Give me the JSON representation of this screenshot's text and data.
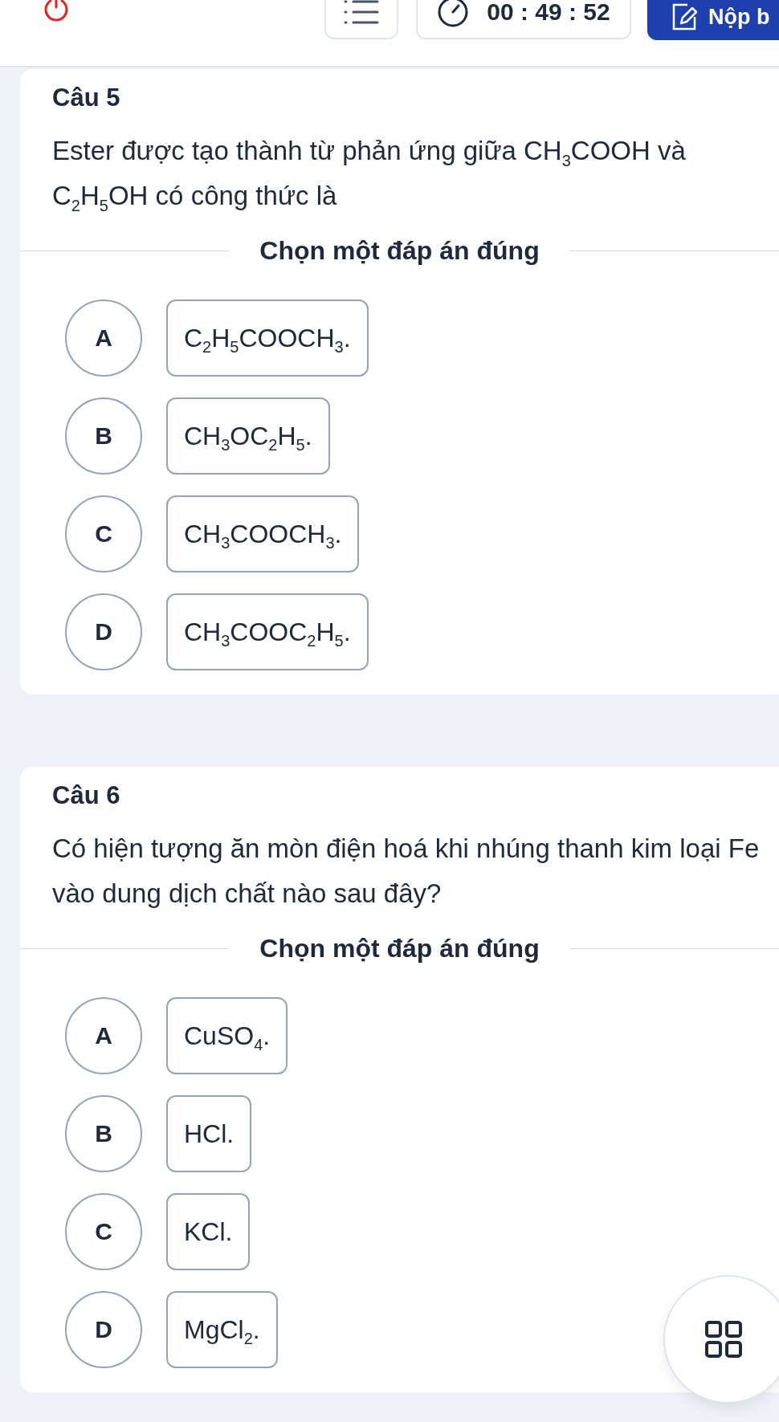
{
  "top_bar": {
    "timer": "00 : 49 : 52",
    "submit_label": "Nộp b"
  },
  "questions": [
    {
      "title": "Câu 5",
      "text": "Ester được tạo thành từ phản ứng giữa CH$_{3}$COOH và C$_{2}$H$_{5}$OH có công thức là",
      "prompt": "Chọn một đáp án đúng",
      "options": [
        {
          "letter": "A",
          "text": "C$_{2}$H$_{5}$COOCH$_{3}$.",
          "selected": false
        },
        {
          "letter": "B",
          "text": "CH$_{3}$OC$_{2}$H$_{5}$.",
          "selected": false
        },
        {
          "letter": "C",
          "text": "CH$_{3}$COOCH$_{3}$.",
          "selected": false
        },
        {
          "letter": "D",
          "text": "CH$_{3}$COOC$_{2}$H$_{5}$.",
          "selected": false
        }
      ]
    },
    {
      "title": "Câu 6",
      "text": "Có hiện tượng ăn mòn điện hoá khi nhúng thanh kim loại Fe vào dung dịch chất nào sau đây?",
      "prompt": "Chọn một đáp án đúng",
      "options": [
        {
          "letter": "A",
          "text": "CuSO$_{4}$.",
          "selected": false
        },
        {
          "letter": "B",
          "text": "HCl.",
          "selected": false
        },
        {
          "letter": "C",
          "text": "KCl.",
          "selected": false
        },
        {
          "letter": "D",
          "text": "MgCl$_{2}$.",
          "selected": false
        }
      ]
    }
  ]
}
